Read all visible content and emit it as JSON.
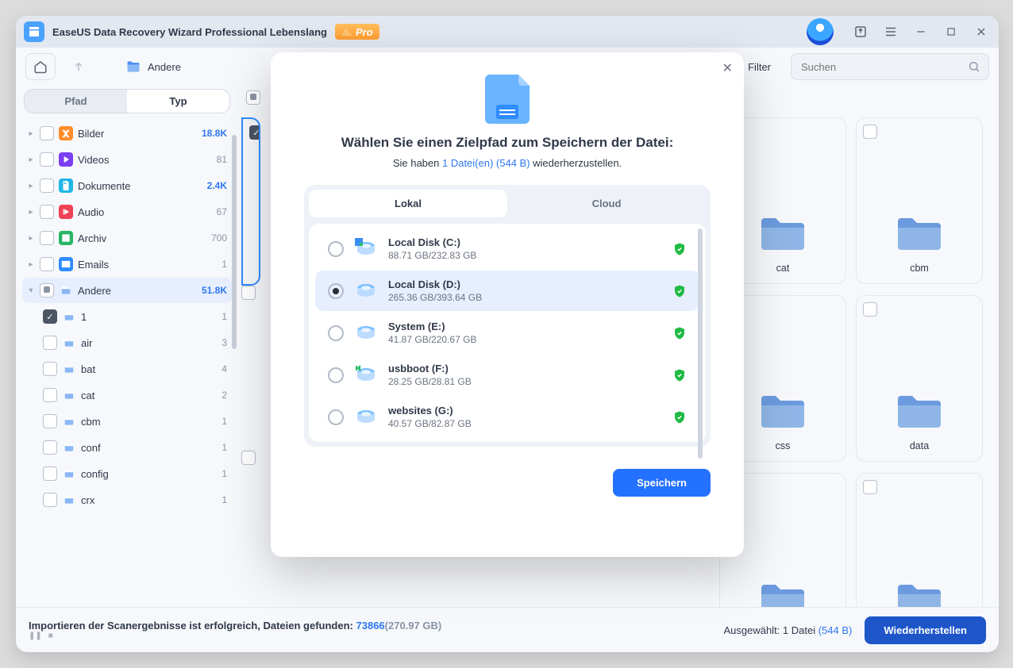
{
  "app": {
    "title": "EaseUS Data Recovery Wizard Professional Lebenslang",
    "pro_badge": "Pro"
  },
  "toolbar": {
    "breadcrumb": "Andere",
    "filter": "Filter",
    "search_placeholder": "Suchen"
  },
  "sidebar": {
    "tab_path": "Pfad",
    "tab_type": "Typ",
    "items": [
      {
        "label": "Bilder",
        "count": "18.8K"
      },
      {
        "label": "Videos",
        "count": "81"
      },
      {
        "label": "Dokumente",
        "count": "2.4K"
      },
      {
        "label": "Audio",
        "count": "67"
      },
      {
        "label": "Archiv",
        "count": "700"
      },
      {
        "label": "Emails",
        "count": "1"
      },
      {
        "label": "Andere",
        "count": "51.8K"
      }
    ],
    "sub": [
      {
        "label": "1",
        "count": "1",
        "checked": true
      },
      {
        "label": "air",
        "count": "3"
      },
      {
        "label": "bat",
        "count": "4"
      },
      {
        "label": "cat",
        "count": "2"
      },
      {
        "label": "cbm",
        "count": "1"
      },
      {
        "label": "conf",
        "count": "1"
      },
      {
        "label": "config",
        "count": "1"
      },
      {
        "label": "crx",
        "count": "1"
      }
    ]
  },
  "grid_names": [
    "",
    "cat",
    "cbm",
    "",
    "css",
    "data",
    "",
    "",
    ""
  ],
  "footer": {
    "status_pre": "Importieren der Scanergebnisse ist erfolgreich, Dateien gefunden: ",
    "count": "73866",
    "size": "(270.97 GB)",
    "selected_pre": "Ausgewählt: 1 Datei ",
    "selected_size": "(544 B)",
    "restore": "Wiederherstellen"
  },
  "modal": {
    "title": "Wählen Sie einen Zielpfad zum Speichern der Datei:",
    "sub_pre": "Sie haben ",
    "sub_link": "1 Datei(en) (544 B)",
    "sub_post": " wiederherzustellen.",
    "tab_local": "Lokal",
    "tab_cloud": "Cloud",
    "save": "Speichern",
    "disks": [
      {
        "label": "Local Disk (C:)",
        "size": "88.71 GB/232.83 GB"
      },
      {
        "label": "Local Disk (D:)",
        "size": "265.36 GB/393.64 GB",
        "selected": true
      },
      {
        "label": "System (E:)",
        "size": "41.87 GB/220.67 GB"
      },
      {
        "label": "usbboot (F:)",
        "size": "28.25 GB/28.81 GB"
      },
      {
        "label": "websites (G:)",
        "size": "40.57 GB/82.87 GB"
      }
    ]
  }
}
